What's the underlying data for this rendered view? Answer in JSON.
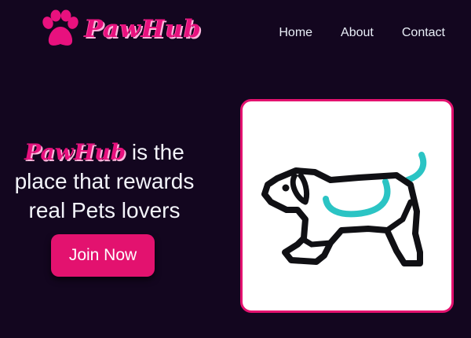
{
  "header": {
    "brand": "PawHub",
    "nav": [
      {
        "label": "Home"
      },
      {
        "label": "About"
      },
      {
        "label": "Contact"
      }
    ]
  },
  "hero": {
    "brand_inline": "PawHub",
    "line1_rest": " is the",
    "line2": "place that rewards",
    "line3": "real Pets lovers",
    "cta": "Join Now"
  },
  "colors": {
    "background": "#13061f",
    "accent": "#e3126f",
    "teal": "#2bc4c4",
    "text": "#e9eef7"
  },
  "icons": [
    "paw-icon",
    "dog-stretch-icon"
  ]
}
